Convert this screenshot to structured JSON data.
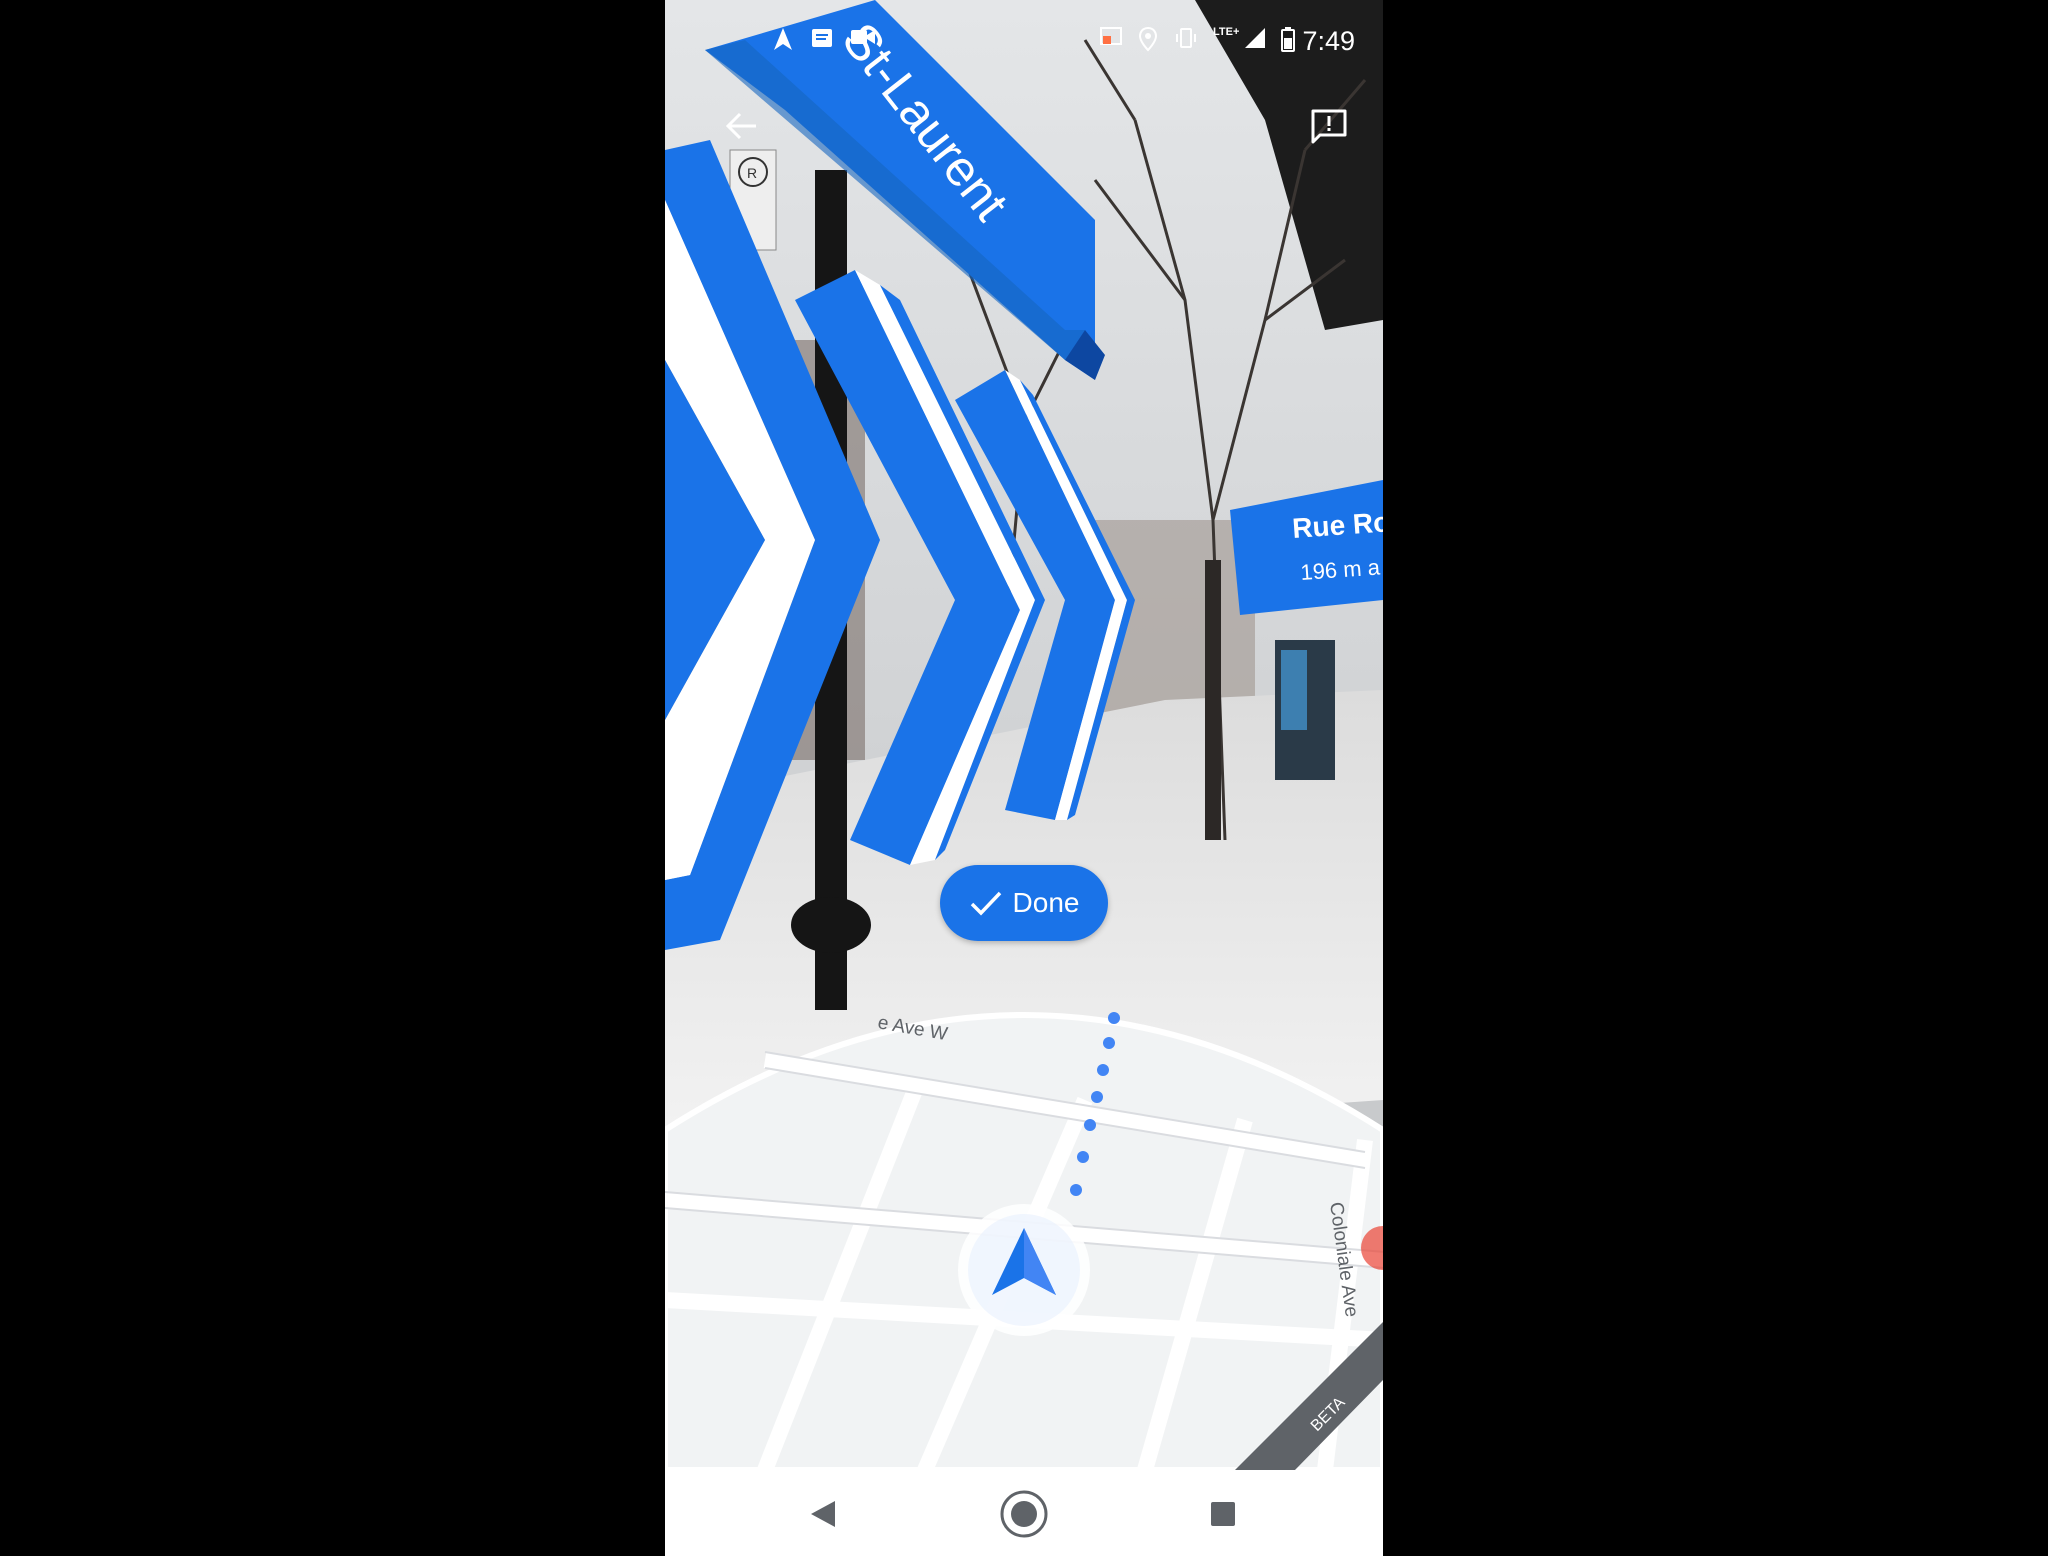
{
  "status_bar": {
    "time": "7:49",
    "network": "LTE+",
    "icons": [
      "navigation-icon",
      "message-icon",
      "video-icon",
      "cast-icon",
      "location-icon",
      "vibrate-icon",
      "signal-icon",
      "battery-icon"
    ]
  },
  "toolbar": {
    "back_icon": "arrow-back-icon",
    "feedback_icon": "feedback-icon"
  },
  "ar_labels": {
    "street_sign": "St-Laurent",
    "next_street": "Rue Ro",
    "next_distance": "196 m a"
  },
  "done_button": {
    "label": "Done",
    "icon": "check-icon"
  },
  "mini_map": {
    "street_top": "e Ave W",
    "street_right": "Coloniale Ave",
    "badge": "BETA",
    "route_color": "#4285f4",
    "position_icon": "navigation-arrow-icon"
  },
  "system_nav": {
    "icons": [
      "back-triangle-icon",
      "home-circle-icon",
      "recents-square-icon"
    ]
  },
  "colors": {
    "accent": "#1a73e8",
    "arrow_blue": "#1a73e8",
    "map_bg": "#f1f3f4"
  }
}
